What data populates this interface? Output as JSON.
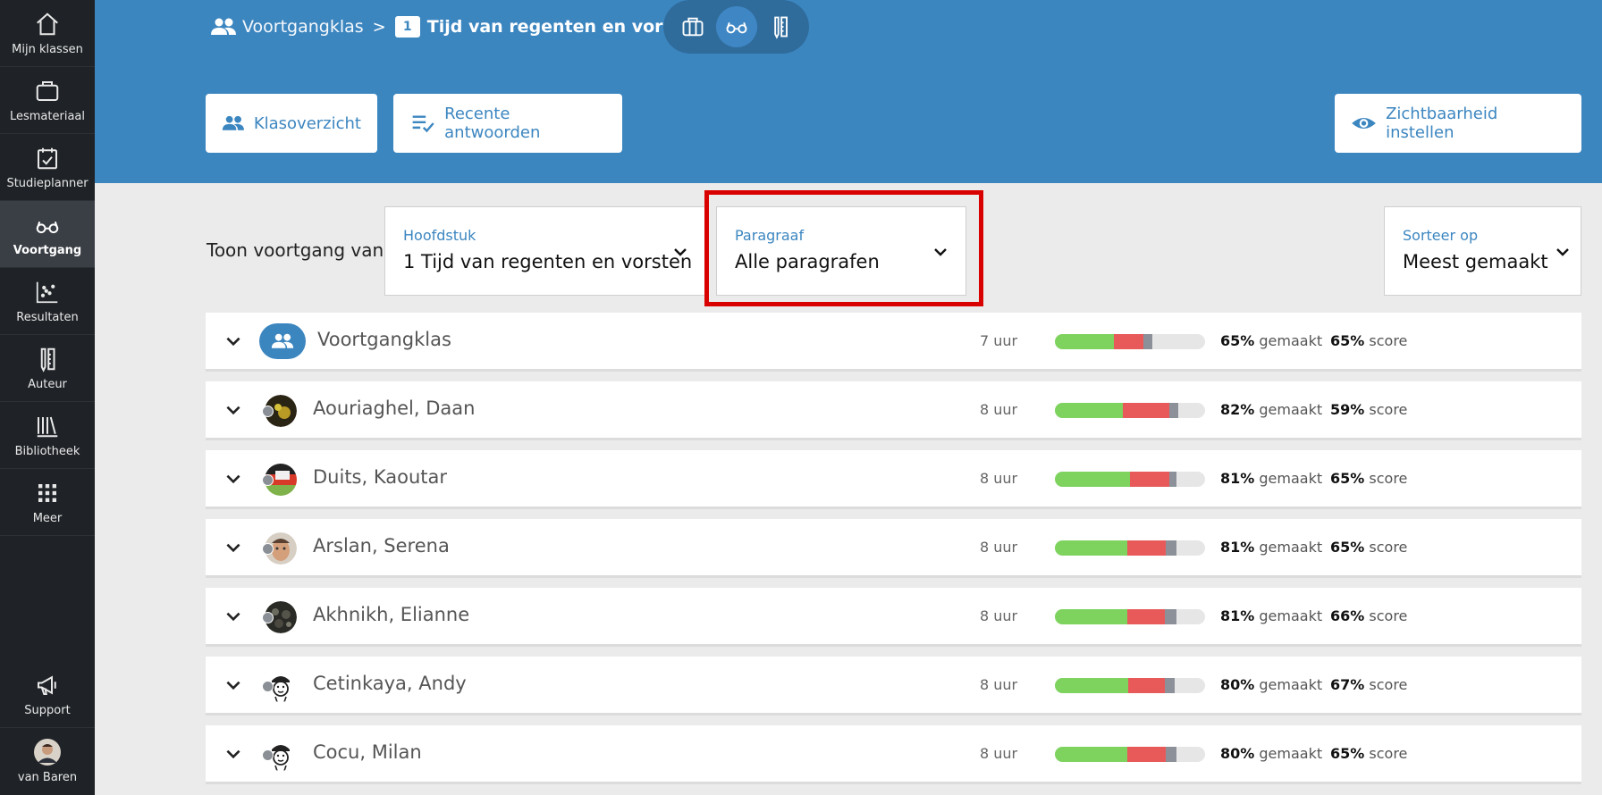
{
  "sidebar": {
    "items": [
      {
        "label": "Mijn klassen",
        "icon": "home-icon"
      },
      {
        "label": "Lesmateriaal",
        "icon": "briefcase-icon"
      },
      {
        "label": "Studieplanner",
        "icon": "calendar-check-icon"
      },
      {
        "label": "Voortgang",
        "icon": "glasses-icon",
        "active": true
      },
      {
        "label": "Resultaten",
        "icon": "scatter-chart-icon"
      },
      {
        "label": "Auteur",
        "icon": "author-tools-icon"
      },
      {
        "label": "Bibliotheek",
        "icon": "library-icon"
      },
      {
        "label": "Meer",
        "icon": "grid-icon"
      }
    ],
    "support_label": "Support",
    "user_label": "van Baren"
  },
  "breadcrumb": {
    "parent": "Voortgangklas",
    "chapter_number": "1",
    "current": "Tijd van regenten en vorsten"
  },
  "header_buttons": {
    "klasoverzicht": "Klasoverzicht",
    "recent": "Recente antwoorden",
    "zichtbaarheid": "Zichtbaarheid instellen"
  },
  "filters": {
    "label": "Toon voortgang van",
    "hoofdstuk": {
      "label": "Hoofdstuk",
      "value": "1 Tijd van regenten en vorsten"
    },
    "paragraaf": {
      "label": "Paragraaf",
      "value": "Alle paragrafen"
    },
    "sort": {
      "label": "Sorteer op",
      "value": "Meest gemaakt"
    }
  },
  "colors": {
    "green": "#7ed35f",
    "red": "#e85a5a",
    "gray": "#8c9199",
    "primary": "#3c86c0",
    "highlight": "#d90000"
  },
  "units": {
    "made": "gemaakt",
    "score": "score"
  },
  "rows": [
    {
      "name": "Voortgangklas",
      "hours": "7 uur",
      "made_pct": "65%",
      "score_pct": "65%",
      "bar": {
        "green": 0.39,
        "red": 0.2,
        "gray": 0.06
      }
    },
    {
      "name": "Aouriaghel, Daan",
      "hours": "8 uur",
      "made_pct": "82%",
      "score_pct": "59%",
      "bar": {
        "green": 0.45,
        "red": 0.31,
        "gray": 0.06
      }
    },
    {
      "name": "Duits, Kaoutar",
      "hours": "8 uur",
      "made_pct": "81%",
      "score_pct": "65%",
      "bar": {
        "green": 0.5,
        "red": 0.26,
        "gray": 0.05
      }
    },
    {
      "name": "Arslan, Serena",
      "hours": "8 uur",
      "made_pct": "81%",
      "score_pct": "65%",
      "bar": {
        "green": 0.48,
        "red": 0.26,
        "gray": 0.07
      }
    },
    {
      "name": "Akhnikh, Elianne",
      "hours": "8 uur",
      "made_pct": "81%",
      "score_pct": "66%",
      "bar": {
        "green": 0.48,
        "red": 0.25,
        "gray": 0.08
      }
    },
    {
      "name": "Cetinkaya, Andy",
      "hours": "8 uur",
      "made_pct": "80%",
      "score_pct": "67%",
      "bar": {
        "green": 0.49,
        "red": 0.24,
        "gray": 0.07
      }
    },
    {
      "name": "Cocu, Milan",
      "hours": "8 uur",
      "made_pct": "80%",
      "score_pct": "65%",
      "bar": {
        "green": 0.48,
        "red": 0.26,
        "gray": 0.07
      }
    }
  ]
}
